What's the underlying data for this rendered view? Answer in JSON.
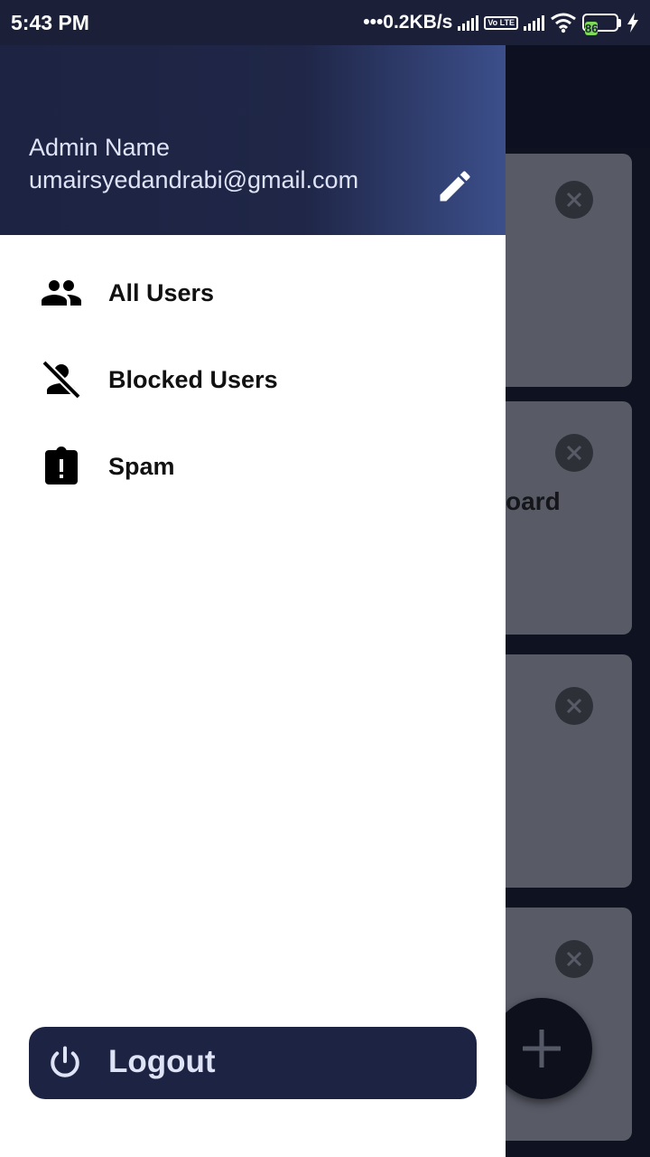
{
  "status_bar": {
    "time": "5:43 PM",
    "network_speed": "•••0.2KB/s",
    "volte": "Vo LTE",
    "battery_level": "86"
  },
  "background": {
    "card_text": "oard",
    "cards": [
      "card-1",
      "card-2",
      "card-3",
      "card-4"
    ]
  },
  "drawer": {
    "header": {
      "admin_name": "Admin Name",
      "admin_email": "umairsyedandrabi@gmail.com",
      "edit_icon": "pencil-icon"
    },
    "menu": [
      {
        "label": "All Users",
        "icon": "people-icon"
      },
      {
        "label": "Blocked Users",
        "icon": "blocked-person-icon"
      },
      {
        "label": "Spam",
        "icon": "report-clipboard-icon"
      }
    ],
    "logout": {
      "label": "Logout",
      "icon": "power-icon"
    }
  },
  "colors": {
    "header_dark": "#1d2342",
    "header_light": "#3c4f8b",
    "card_bg": "#585a66",
    "battery": "#7ed957"
  }
}
